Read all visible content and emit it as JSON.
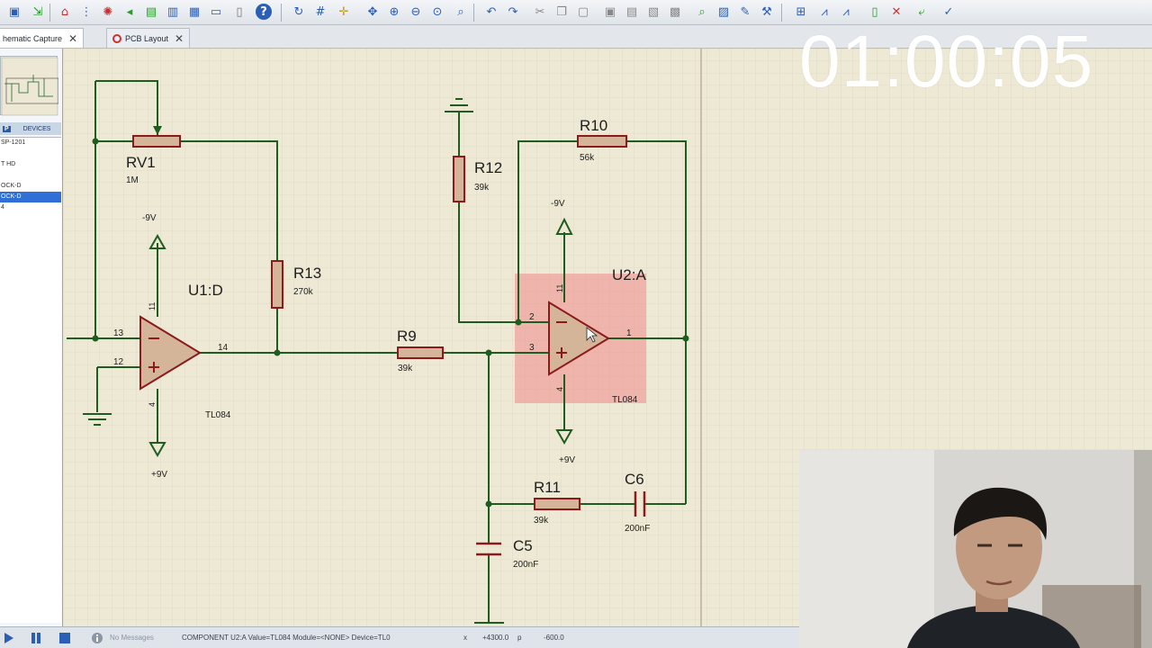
{
  "timer": "01:00:05",
  "tabs": [
    {
      "label": "hematic Capture",
      "close": "✕"
    },
    {
      "label": "PCB Layout",
      "close": "✕"
    }
  ],
  "device_panel": {
    "header_mode": "P",
    "header_label": "DEVICES",
    "items": [
      "SP-1201",
      "",
      "T HD",
      "",
      "OCK-D",
      "OCK-D",
      "4"
    ],
    "selected_index": 5
  },
  "schematic": {
    "components": [
      {
        "ref": "RV1",
        "value": "1M"
      },
      {
        "ref": "R13",
        "value": "270k"
      },
      {
        "ref": "U1:D",
        "value": "TL084"
      },
      {
        "ref": "R9",
        "value": "39k"
      },
      {
        "ref": "R12",
        "value": "39k"
      },
      {
        "ref": "R10",
        "value": "56k"
      },
      {
        "ref": "U2:A",
        "value": "TL084"
      },
      {
        "ref": "R11",
        "value": "39k"
      },
      {
        "ref": "C6",
        "value": "200nF"
      },
      {
        "ref": "C5",
        "value": "200nF"
      }
    ],
    "rails": {
      "u1_top": "-9V",
      "u1_bottom": "+9V",
      "u2_top": "-9V",
      "u2_bottom": "+9V"
    },
    "pins": {
      "u1_inv": "13",
      "u1_non": "12",
      "u1_out": "14",
      "u1_vtop": "11",
      "u1_vbot": "4",
      "u2_inv": "2",
      "u2_non": "3",
      "u2_out": "1",
      "u2_vtop": "11",
      "u2_vbot": "4"
    }
  },
  "status_bar": {
    "messages": "No Messages",
    "info": "COMPONENT U2:A Value=TL084 Module=<NONE> Device=TL0",
    "x": "+4300.0",
    "x_unit": "p",
    "y": "-600.0"
  },
  "colors": {
    "canvas_bg": "#ede9d4",
    "wire": "#1f5c1f",
    "component": "#8b1a1a",
    "component_fill": "#d4b59a",
    "highlight": "#f08a8a"
  }
}
